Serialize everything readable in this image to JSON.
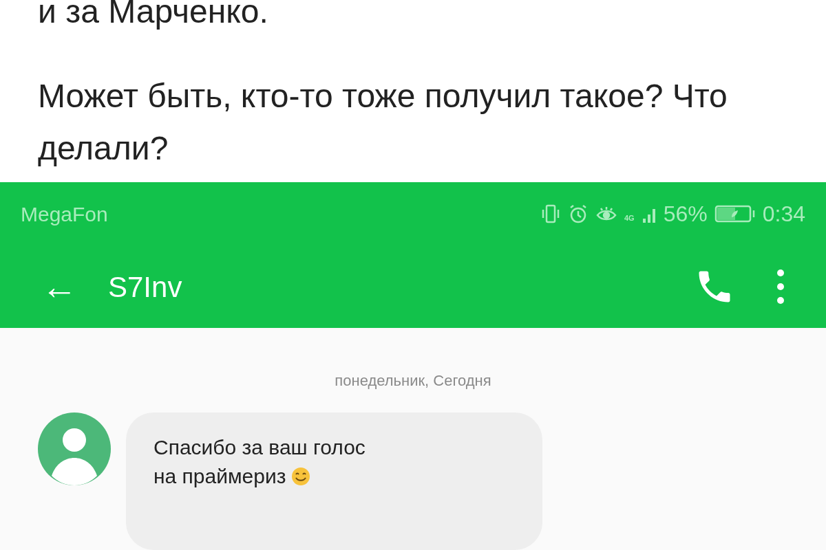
{
  "article": {
    "lines": [
      "и за Марченко.",
      "Может быть, кто-то тоже получил такое? Что делали?"
    ]
  },
  "phone": {
    "status_bar": {
      "carrier": "MegaFon",
      "network": "4G",
      "battery": "56%",
      "time": "0:34"
    },
    "toolbar": {
      "back": "←",
      "contact": "S7Inv"
    },
    "date_label": "понедельник, Сегодня",
    "messages": [
      {
        "text": "Спасибо за ваш голос на праймериз",
        "emoji": true
      }
    ]
  }
}
